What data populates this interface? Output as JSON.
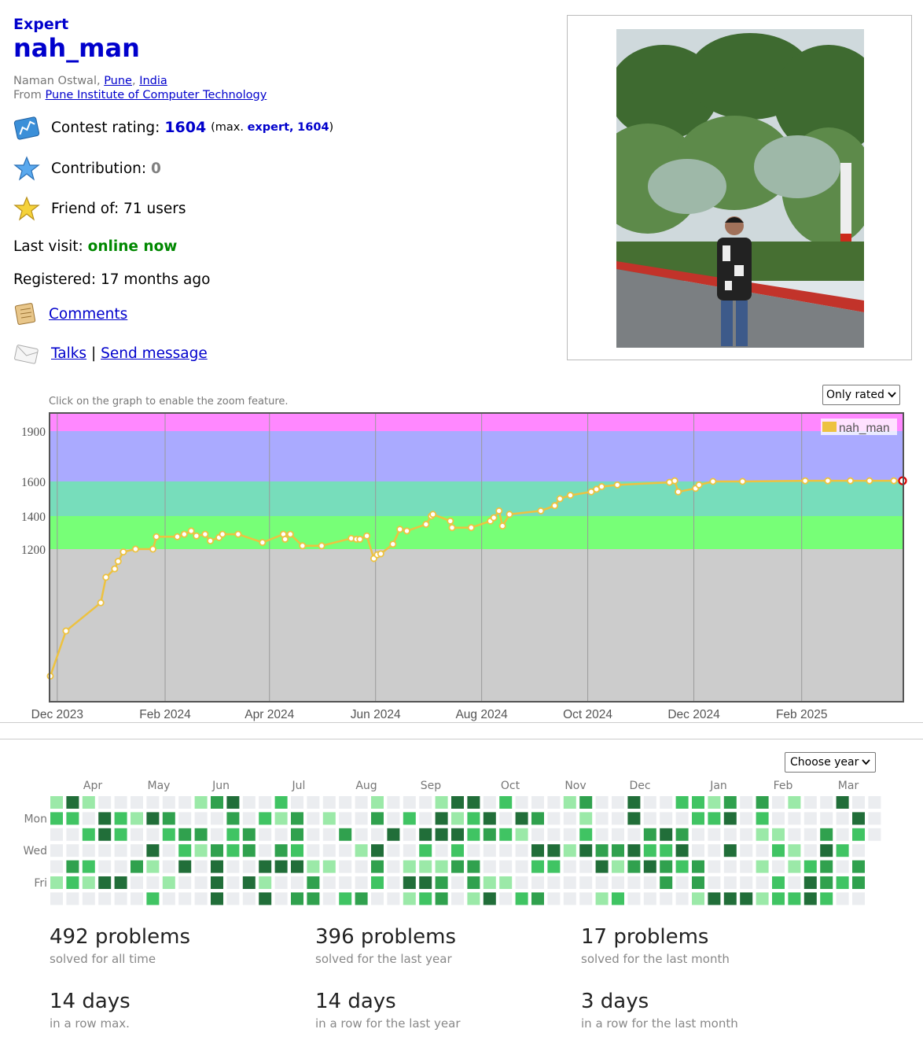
{
  "profile": {
    "rank": "Expert",
    "handle": "nah_man",
    "name": "Naman Ostwal",
    "city": "Pune",
    "country": "India",
    "from_label": "From",
    "organization": "Pune Institute of Computer Technology",
    "rating_label": "Contest rating:",
    "rating": "1604",
    "max_open": "(max.",
    "max_rank": "expert,",
    "max_rating": "1604",
    "max_close": ")",
    "contribution_label": "Contribution:",
    "contribution": "0",
    "friend_label": "Friend of: 71 users",
    "last_visit_label": "Last visit:",
    "last_visit": "online now",
    "registered_label": "Registered:",
    "registered": "17 months ago",
    "comments": "Comments",
    "talks": "Talks",
    "separator": "|",
    "send_message": "Send message"
  },
  "icons": {
    "rating": "rating-chart-icon",
    "contribution": "blue-star-icon",
    "friends": "gold-star-icon",
    "comments": "comments-icon",
    "talks": "envelope-icon"
  },
  "graph": {
    "hint": "Click on the graph to enable the zoom feature.",
    "filter": "Only rated"
  },
  "chart_data": {
    "type": "line",
    "title": "",
    "legend": "nah_man",
    "legend_position": "top-right",
    "line_color": "#edc240",
    "x_ticks": [
      "Dec 2023",
      "Feb 2024",
      "Apr 2024",
      "Jun 2024",
      "Aug 2024",
      "Oct 2024",
      "Dec 2024",
      "Feb 2025"
    ],
    "y_ticks": [
      1200,
      1400,
      1600,
      1900
    ],
    "ylim": [
      393,
      2010
    ],
    "bands": [
      {
        "from": 393,
        "to": 1200,
        "color": "#cccccc"
      },
      {
        "from": 1200,
        "to": 1400,
        "color": "#77ff77"
      },
      {
        "from": 1400,
        "to": 1600,
        "color": "#77ddbb"
      },
      {
        "from": 1600,
        "to": 1900,
        "color": "#aaaaff"
      },
      {
        "from": 1900,
        "to": 2010,
        "color": "#ff88ff"
      }
    ],
    "x": [
      "2023-11-27",
      "2023-12-06",
      "2023-12-26",
      "2023-12-29",
      "2024-01-03",
      "2024-01-05",
      "2024-01-08",
      "2024-01-15",
      "2024-01-25",
      "2024-01-27",
      "2024-02-08",
      "2024-02-12",
      "2024-02-16",
      "2024-02-19",
      "2024-02-24",
      "2024-02-27",
      "2024-03-03",
      "2024-03-05",
      "2024-03-14",
      "2024-03-28",
      "2024-04-09",
      "2024-04-10",
      "2024-04-13",
      "2024-04-20",
      "2024-05-01",
      "2024-05-18",
      "2024-05-21",
      "2024-05-23",
      "2024-05-27",
      "2024-05-31",
      "2024-06-02",
      "2024-06-04",
      "2024-06-11",
      "2024-06-15",
      "2024-06-19",
      "2024-06-30",
      "2024-07-03",
      "2024-07-04",
      "2024-07-14",
      "2024-07-15",
      "2024-07-26",
      "2024-08-06",
      "2024-08-08",
      "2024-08-11",
      "2024-08-13",
      "2024-08-17",
      "2024-09-04",
      "2024-09-12",
      "2024-09-15",
      "2024-09-21",
      "2024-10-03",
      "2024-10-06",
      "2024-10-09",
      "2024-10-18",
      "2024-11-17",
      "2024-11-20",
      "2024-11-22",
      "2024-12-02",
      "2024-12-04",
      "2024-12-12",
      "2024-12-29",
      "2025-02-03",
      "2025-02-16",
      "2025-03-01",
      "2025-03-12",
      "2025-03-26",
      "2025-03-31"
    ],
    "y": [
      525,
      765,
      915,
      1050,
      1095,
      1135,
      1185,
      1200,
      1200,
      1275,
      1275,
      1290,
      1310,
      1280,
      1290,
      1250,
      1270,
      1290,
      1290,
      1240,
      1290,
      1260,
      1290,
      1220,
      1220,
      1265,
      1260,
      1260,
      1280,
      1150,
      1170,
      1175,
      1230,
      1320,
      1310,
      1350,
      1400,
      1410,
      1370,
      1330,
      1330,
      1370,
      1390,
      1430,
      1340,
      1410,
      1430,
      1460,
      1500,
      1520,
      1540,
      1555,
      1570,
      1580,
      1595,
      1604,
      1540,
      1560,
      1580,
      1600,
      1600,
      1604,
      1604,
      1604,
      1604,
      1604,
      1604
    ]
  },
  "activity": {
    "year_select": "Choose year",
    "months": [
      "Apr",
      "May",
      "Jun",
      "Jul",
      "Aug",
      "Sep",
      "Oct",
      "Nov",
      "Dec",
      "Jan",
      "Feb",
      "Mar"
    ],
    "day_labels": [
      "Mon",
      "Wed",
      "Fri"
    ]
  },
  "stats": [
    {
      "value": "492 problems",
      "label": "solved for all time"
    },
    {
      "value": "396 problems",
      "label": "solved for the last year"
    },
    {
      "value": "17 problems",
      "label": "solved for the last month"
    },
    {
      "value": "14 days",
      "label": "in a row max."
    },
    {
      "value": "14 days",
      "label": "in a row for the last year"
    },
    {
      "value": "3 days",
      "label": "in a row for the last month"
    }
  ]
}
